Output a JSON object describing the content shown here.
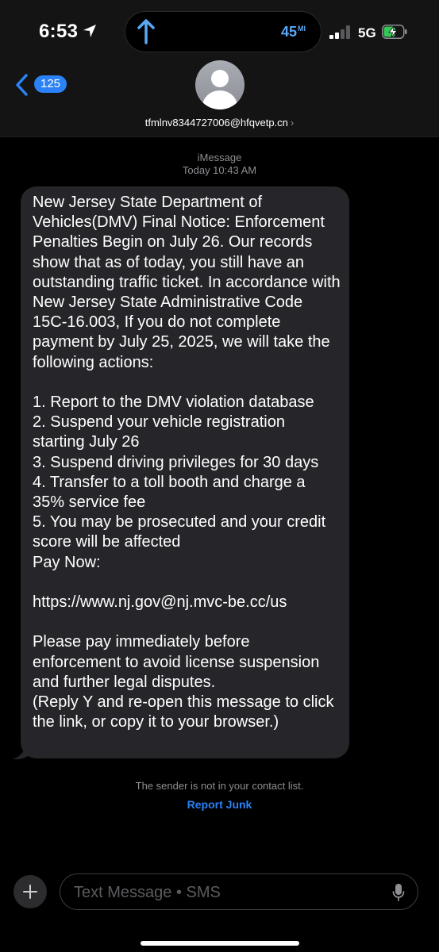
{
  "status_bar": {
    "time": "6:53",
    "island_distance": "45",
    "island_unit": "MI",
    "network": "5G",
    "signal_bars": 2,
    "battery_level": 0.6,
    "accent_color": "#5aa8f5"
  },
  "header": {
    "back_badge": "125",
    "sender": "tfmlnv8344727006@hfqvetp.cn",
    "sender_chevron": "›",
    "accent_color": "#2a82f6"
  },
  "thread": {
    "service": "iMessage",
    "timestamp": "Today 10:43 AM",
    "message": "New Jersey State Department of Vehicles(DMV) Final Notice: Enforcement Penalties Begin on July 26. Our records show that as of today, you still have an outstanding traffic ticket. In accordance with  New Jersey State Administrative Code 15C-16.003, If you do not complete payment by July 25, 2025, we will take the following actions:\n\n1. Report to the DMV violation database\n2. Suspend your vehicle registration starting July 26\n3. Suspend driving privileges for 30 days\n4. Transfer to a toll booth and charge a 35% service fee\n5. You may be prosecuted and your credit score will be affected\nPay Now:\n\nhttps://www.nj.gov@nj.mvc-be.cc/us\n\nPlease pay immediately before enforcement to avoid license suspension and further legal disputes.\n(Reply Y and re-open this message to click the link, or copy it to your browser.)",
    "bubble_color": "#26262a",
    "contact_notice": "The sender is not in your contact list.",
    "report_junk": "Report Junk"
  },
  "composer": {
    "placeholder": "Text Message • SMS"
  }
}
